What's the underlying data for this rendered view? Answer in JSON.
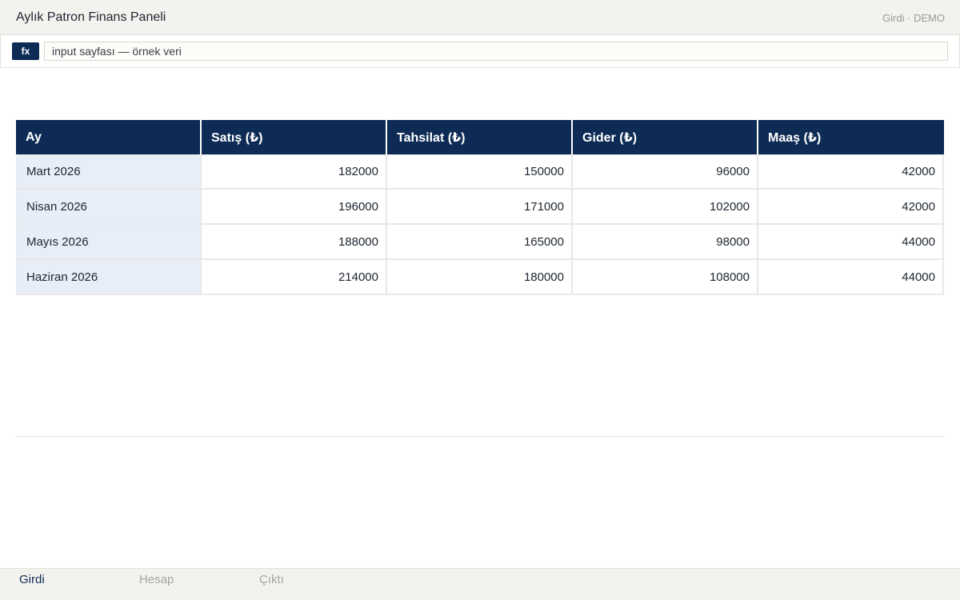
{
  "app": {
    "title": "Aylık Patron Finans Paneli",
    "sheet_badge": "Girdi · DEMO"
  },
  "formula_bar": {
    "fx_label": "fx",
    "value": "input sayfası — örnek veri"
  },
  "table": {
    "headers": [
      "Ay",
      "Satış (₺)",
      "Tahsilat (₺)",
      "Gider (₺)",
      "Maaş (₺)"
    ],
    "rows": [
      {
        "month": "Mart 2026",
        "sales": "182000",
        "collections": "150000",
        "expenses": "96000",
        "salary": "42000"
      },
      {
        "month": "Nisan 2026",
        "sales": "196000",
        "collections": "171000",
        "expenses": "102000",
        "salary": "42000"
      },
      {
        "month": "Mayıs 2026",
        "sales": "188000",
        "collections": "165000",
        "expenses": "98000",
        "salary": "44000"
      },
      {
        "month": "Haziran 2026",
        "sales": "214000",
        "collections": "180000",
        "expenses": "108000",
        "salary": "44000"
      }
    ]
  },
  "tabs": [
    {
      "label": "Girdi",
      "active": true
    },
    {
      "label": "Hesap",
      "active": false
    },
    {
      "label": "Çıktı",
      "active": false
    }
  ],
  "colors": {
    "accent": "#0d2b55",
    "month_cell_bg": "#e8eef8",
    "chrome_bg": "#f3f2ee",
    "inactive_tab": "#a4a4a4"
  }
}
